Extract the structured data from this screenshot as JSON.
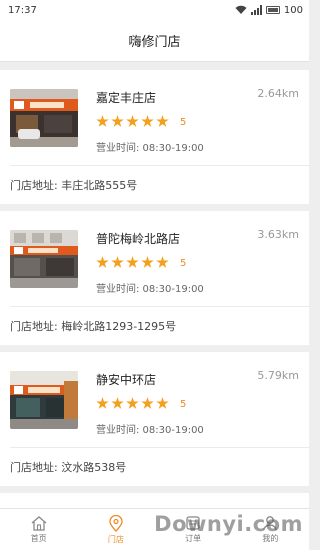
{
  "status_bar": {
    "time": "17:37",
    "battery": "100",
    "icons": [
      "wifi-icon",
      "signal-icon",
      "battery-icon"
    ]
  },
  "header": {
    "title": "嗨修门店"
  },
  "stores": [
    {
      "name": "嘉定丰庄店",
      "distance": "2.64km",
      "rating": "5",
      "rating_value": 5,
      "hours": "营业时间: 08:30-19:00",
      "address": "门店地址: 丰庄北路555号"
    },
    {
      "name": "普陀梅岭北路店",
      "distance": "3.63km",
      "rating": "5",
      "rating_value": 5,
      "hours": "营业时间: 08:30-19:00",
      "address": "门店地址: 梅岭北路1293-1295号"
    },
    {
      "name": "静安中环店",
      "distance": "5.79km",
      "rating": "5",
      "rating_value": 5,
      "hours": "营业时间: 08:30-19:00",
      "address": "门店地址: 汶水路538号"
    }
  ],
  "tabs": [
    {
      "label": "首页",
      "icon": "home-icon",
      "active": false
    },
    {
      "label": "门店",
      "icon": "location-icon",
      "active": true
    },
    {
      "label": "订单",
      "icon": "order-icon",
      "active": false
    },
    {
      "label": "我的",
      "icon": "user-icon",
      "active": false
    }
  ],
  "watermark": "Downyi.com",
  "colors": {
    "accent": "#f08a24",
    "star": "#f4a01e",
    "background": "#eeeeef"
  }
}
